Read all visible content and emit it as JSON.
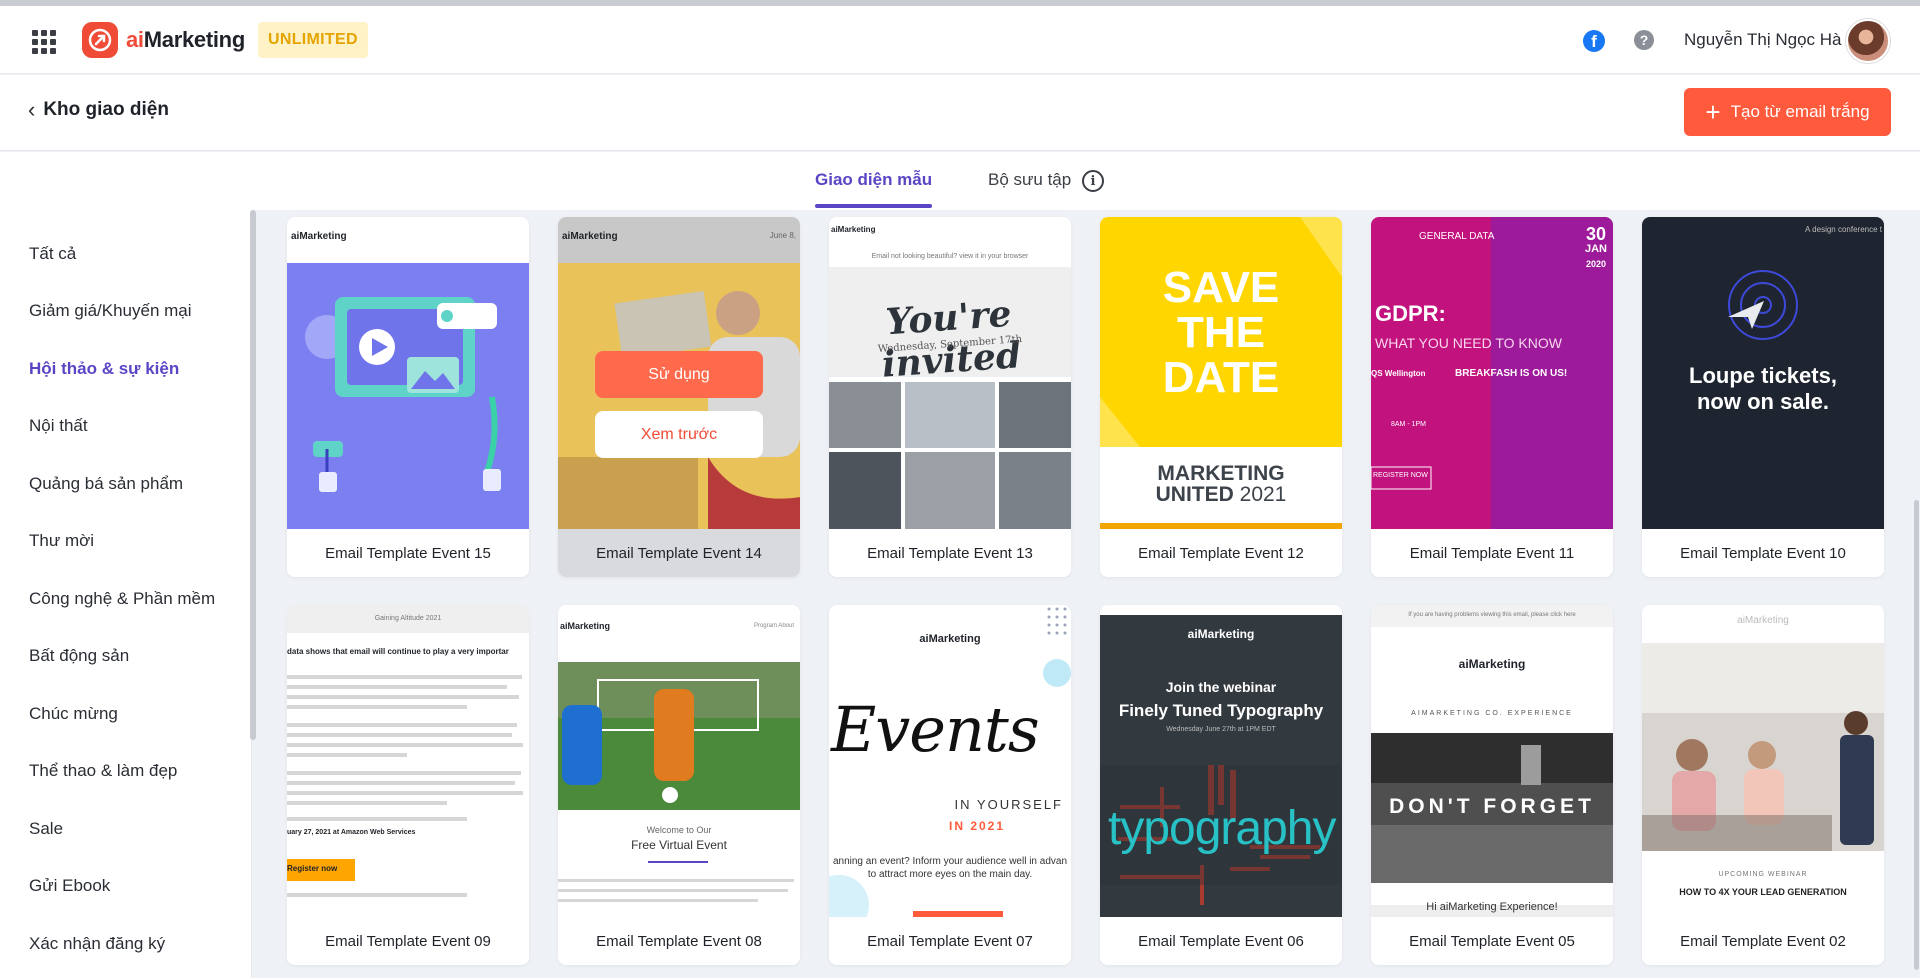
{
  "header": {
    "brand_prefix": "ai",
    "brand_name": "Marketing",
    "plan_badge": "UNLIMITED",
    "user_name": "Nguyễn Thị Ngọc Hà",
    "apps_icon": "grid-icon",
    "facebook_icon": "facebook-icon",
    "help_icon": "help-icon"
  },
  "subheader": {
    "back_title": "Kho giao diện",
    "create_button": "Tạo từ email trắng"
  },
  "tabs": [
    {
      "label": "Giao diện mẫu",
      "active": true
    },
    {
      "label": "Bộ sưu tập",
      "active": false
    }
  ],
  "sidebar": {
    "items": [
      "Tất cả",
      "Giảm giá/Khuyến mại",
      "Hội thảo & sự kiện",
      "Nội thất",
      "Quảng bá sản phẩm",
      "Thư mời",
      "Công nghệ & Phần mềm",
      "Bất động sản",
      "Chúc mừng",
      "Thể thao & làm đẹp",
      "Sale",
      "Gửi Ebook",
      "Xác nhận đăng ký"
    ],
    "active_index": 2
  },
  "overlay": {
    "use_button": "Sử dụng",
    "preview_button": "Xem trước"
  },
  "templates": [
    {
      "name": "Email Template Event 15"
    },
    {
      "name": "Email Template Event 14"
    },
    {
      "name": "Email Template Event 13"
    },
    {
      "name": "Email Template Event 12"
    },
    {
      "name": "Email Template Event 11"
    },
    {
      "name": "Email Template Event 10"
    },
    {
      "name": "Email Template Event 09"
    },
    {
      "name": "Email Template Event 08"
    },
    {
      "name": "Email Template Event 07"
    },
    {
      "name": "Email Template Event 06"
    },
    {
      "name": "Email Template Event 05"
    },
    {
      "name": "Email Template Event 02"
    }
  ],
  "thumb_text": {
    "t15_brand": "aiMarketing",
    "t14_brand": "aiMarketing",
    "t14_date": "June 8,",
    "t13_brand": "aiMarketing",
    "t13_notice": "Email not looking beautiful? view it in your browser",
    "t13_title": "You're invited",
    "t13_date": "Wednesday, September 17th",
    "t12_line1": "SAVE",
    "t12_line2": "THE",
    "t12_line3": "DATE",
    "t12_sub1": "MARKETING",
    "t12_sub2": "UNITED",
    "t12_year": "2021",
    "t11_label": "GENERAL DATA",
    "t11_day": "30",
    "t11_month": "JAN",
    "t11_year": "2020",
    "t11_title": "GDPR:",
    "t11_subtitle": "WHAT YOU NEED TO KNOW",
    "t11_location": "QS Wellington",
    "t11_head": "BREAKFASH IS ON US!",
    "t11_time": "8AM - 1PM",
    "t11_register": "REGISTER NOW",
    "t10_top": "A design conference t",
    "t10_title1": "Loupe tickets,",
    "t10_title2": "now on sale.",
    "t09_top": "Gaining Altitude 2021",
    "t09_lead": "data shows that email will continue to play a very importar",
    "t09_date": "uary 27, 2021 at Amazon Web Services",
    "t09_button": "Register now",
    "t08_brand": "aiMarketing",
    "t08_nav": "Program   About",
    "t08_welcome": "Welcome to Our",
    "t08_event": "Free Virtual Event",
    "t07_brand": "aiMarketing",
    "t07_script": "Events",
    "t07_in": "IN YOURSELF",
    "t07_year": "IN 2021",
    "t07_copy": "anning an event? Inform your audience well in advan to attract more eyes on the main day.",
    "t06_brand": "aiMarketing",
    "t06_join": "Join the webinar",
    "t06_title": "Finely Tuned Typography",
    "t06_date": "Wednesday June 27th at 1PM EDT",
    "t06_word": "typography",
    "t05_notice": "If you are having problems viewing this email, please click here",
    "t05_brand": "aiMarketing",
    "t05_tag": "AIMARKETING CO. EXPERIENCE",
    "t05_title": "DON'T FORGET",
    "t05_footer": "Hi aiMarketing Experience!",
    "t02_brand": "aiMarketing",
    "t02_upcoming": "UPCOMING WEBINAR",
    "t02_title": "HOW TO 4X YOUR LEAD GENERATION"
  },
  "colors": {
    "accent": "#5b45c5",
    "brand": "#ef4b37",
    "create_button": "#ff5a3c",
    "badge_bg": "#fff2c7",
    "badge_text": "#e5a400"
  }
}
